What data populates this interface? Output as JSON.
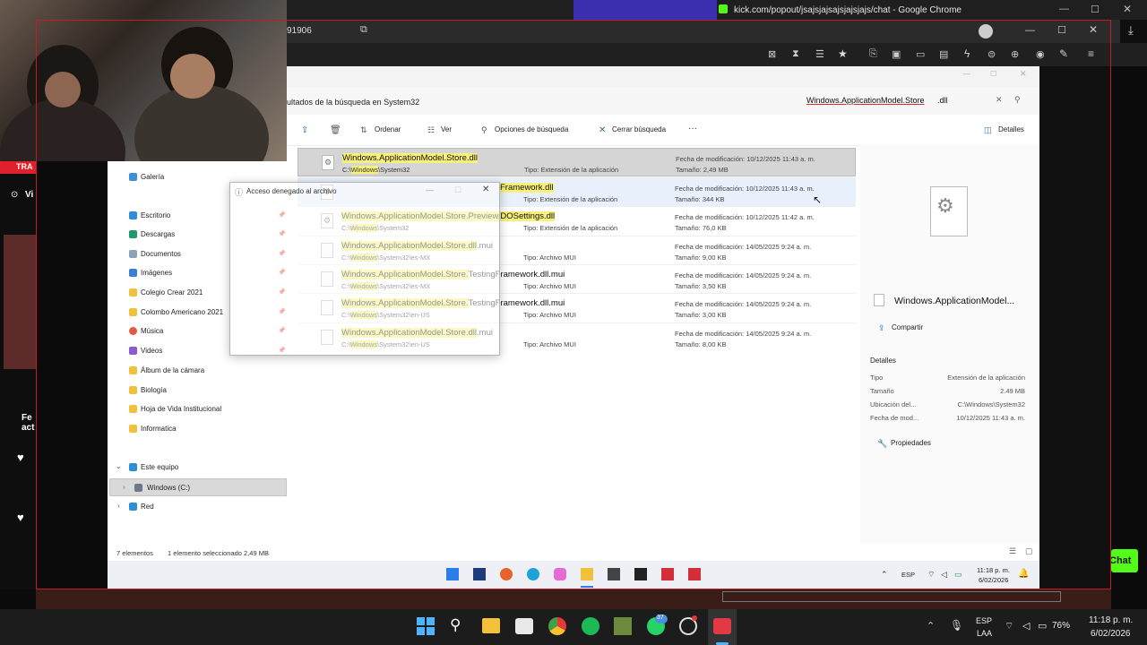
{
  "chrome": {
    "popup_title": "kick.com/popout/jsajsjajsajsjajsjajs/chat - Google Chrome",
    "address_fragment": "91906"
  },
  "stream_overlay": {
    "left_label_1": "TRA",
    "left_label_2": "Vi",
    "left_label_3": "Fe",
    "left_label_4": "act",
    "chat_button": "Chat"
  },
  "explorer": {
    "breadcrumb": "ultados de la búsqueda en System32",
    "search_value_prefix": "Windows.ApplicationModel.Store",
    "search_value_suffix": ".dll",
    "toolbar": {
      "ordenar": "Ordenar",
      "ver": "Ver",
      "opciones": "Opciones de búsqueda",
      "cerrar": "Cerrar búsqueda",
      "more": "···",
      "detalles": "Detalles"
    },
    "nav": {
      "galeria": "Galería",
      "escritorio": "Escritorio",
      "descargas": "Descargas",
      "documentos": "Documentos",
      "imagenes": "Imágenes",
      "colegio": "Colegio Crear 2021",
      "colombo": "Colombo Americano 2021",
      "musica": "Música",
      "videos": "Videos",
      "album": "Álbum de la cámara",
      "biologia": "Biología",
      "hoja": "Hoja de Vida Institucional",
      "informatica": "Informatica",
      "este_equipo": "Este equipo",
      "windows_c": "Windows (C:)",
      "red": "Red"
    },
    "files": [
      {
        "name_hl": "Windows.ApplicationModel.Store.dll",
        "name_rest": "",
        "path_pre": "C:\\",
        "path_hl": "Windows",
        "path_post": "\\System32",
        "type": "Tipo: Extensión de la aplicación",
        "modified": "Fecha de modificación: 10/12/2025 11:43 a. m.",
        "size": "Tamaño: 2,49 MB"
      },
      {
        "name_hl": "",
        "name_rest": "Framework.dll",
        "path_pre": "C:\\",
        "path_hl": "Windows",
        "path_post": "\\System32",
        "type": "Tipo: Extensión de la aplicación",
        "modified": "Fecha de modificación: 10/12/2025 11:43 a. m.",
        "size": "Tamaño: 344 KB"
      },
      {
        "name_hl": "Windows.ApplicationModel.Store.Preview.DOSettings.dll",
        "name_rest": "",
        "path_pre": "C:\\",
        "path_hl": "Windows",
        "path_post": "\\System32",
        "type": "Tipo: Extensión de la aplicación",
        "modified": "Fecha de modificación: 10/12/2025 11:42 a. m.",
        "size": "Tamaño: 76,0 KB"
      },
      {
        "name_hl": "Windows.ApplicationModel.Store.dll",
        "name_rest": ".mui",
        "path_pre": "C:\\",
        "path_hl": "Windows",
        "path_post": "\\System32\\es-MX",
        "type": "Tipo: Archivo MUI",
        "modified": "Fecha de modificación: 14/05/2025 9:24 a. m.",
        "size": "Tamaño: 9,00 KB"
      },
      {
        "name_hl": "Windows.ApplicationModel.Store.",
        "name_rest": "TestingFramework.dll.mui",
        "path_pre": "C:\\",
        "path_hl": "Windows",
        "path_post": "\\System32\\es-MX",
        "type": "Tipo: Archivo MUI",
        "modified": "Fecha de modificación: 14/05/2025 9:24 a. m.",
        "size": "Tamaño: 3,50 KB"
      },
      {
        "name_hl": "Windows.ApplicationModel.Store.",
        "name_rest": "TestingFramework.dll.mui",
        "path_pre": "C:\\",
        "path_hl": "Windows",
        "path_post": "\\System32\\en-US",
        "type": "Tipo: Archivo MUI",
        "modified": "Fecha de modificación: 14/05/2025 9:24 a. m.",
        "size": "Tamaño: 3,00 KB"
      },
      {
        "name_hl": "Windows.ApplicationModel.Store.dll",
        "name_rest": ".mui",
        "path_pre": "C:\\",
        "path_hl": "Windows",
        "path_post": "\\System32\\en-US",
        "type": "Tipo: Archivo MUI",
        "modified": "Fecha de modificación: 14/05/2025 9:24 a. m.",
        "size": "Tamaño: 8,00 KB"
      }
    ],
    "details": {
      "filename": "Windows.ApplicationModel...",
      "compartir": "Compartir",
      "heading": "Detalles",
      "tipo_label": "Tipo",
      "tipo_value": "Extensión de la aplicación",
      "tamano_label": "Tamaño",
      "tamano_value": "2.49 MB",
      "ubicacion_label": "Ubicación del...",
      "ubicacion_value": "C:\\Windows\\System32",
      "fecha_label": "Fecha de mod...",
      "fecha_value": "10/12/2025 11:43 a. m.",
      "propiedades": "Propiedades"
    },
    "status": {
      "count": "7 elementos",
      "selected": "1 elemento seleccionado  2,49 MB"
    },
    "dialog_title": "Acceso denegado al archivo"
  },
  "inner_taskbar": {
    "lang": "ESP",
    "time": "11:18 p. m.",
    "date": "6/02/2026"
  },
  "win_taskbar": {
    "lang_1": "ESP",
    "lang_2": "LAA",
    "battery": "76%",
    "time": "11:18 p. m.",
    "date": "6/02/2026",
    "whatsapp_badge": "37"
  }
}
